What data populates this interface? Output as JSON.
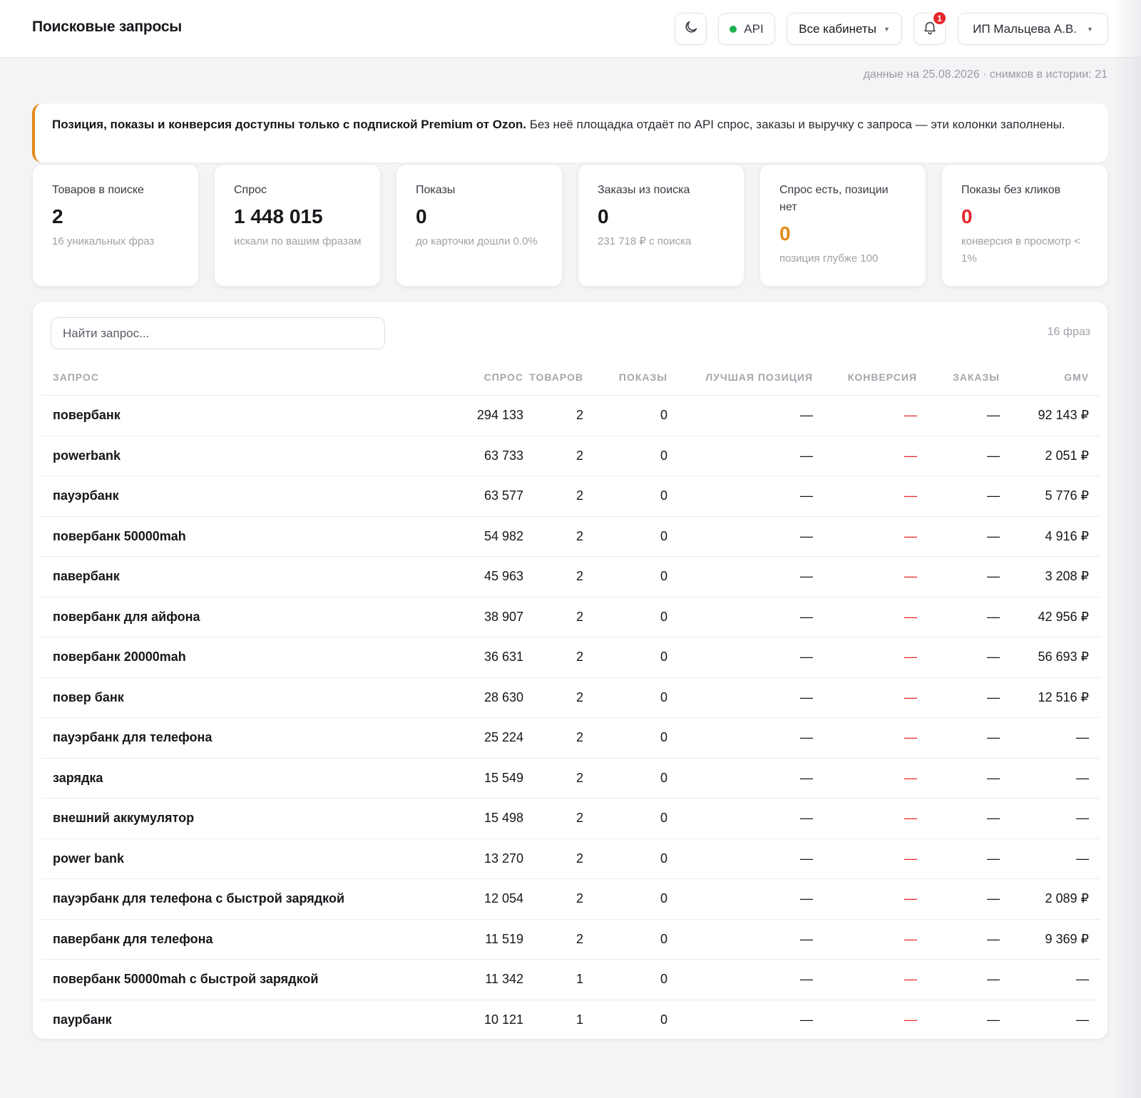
{
  "header": {
    "title": "Поисковые запросы",
    "api_label": "API",
    "cabinets_label": "Все кабинеты",
    "notifications_count": "1",
    "user_label": "ИП Мальцева А.В."
  },
  "data_note": "данные на 25.08.2026 · снимков в истории: 21",
  "notice": {
    "bold": "Позиция, показы и конверсия доступны только с подпиской Premium от Ozon.",
    "text": " Без неё площадка отдаёт по API спрос, заказы и выручку с запроса — эти колонки заполнены."
  },
  "cards": [
    {
      "label": "Товаров в поиске",
      "value": "2",
      "sub": "16 уникальных фраз"
    },
    {
      "label": "Спрос",
      "value": "1 448 015",
      "sub": "искали по вашим фразам"
    },
    {
      "label": "Показы",
      "value": "0",
      "sub": "до карточки дошли 0.0%"
    },
    {
      "label": "Заказы из поиска",
      "value": "0",
      "sub": "231 718 ₽ с поиска"
    },
    {
      "label": "Спрос есть, позиции нет",
      "value": "0",
      "sub": "позиция глубже 100"
    },
    {
      "label": "Показы без кликов",
      "value": "0",
      "sub": "конверсия в просмотр < 1%"
    }
  ],
  "colors": {
    "accent_orange": "#e08a17",
    "alert_red": "#e5262b",
    "api_green": "#1fae4b"
  },
  "table": {
    "search_placeholder": "Найти запрос...",
    "phrase_count": "16 фраз",
    "columns": [
      "Запрос",
      "Спрос",
      "Товаров",
      "Показы",
      "Лучшая позиция",
      "Конверсия",
      "Заказы",
      "GMV"
    ],
    "rows": [
      {
        "query": "повербанк",
        "demand": "294 133",
        "goods": "2",
        "shows": "0",
        "position": "—",
        "conversion": "—",
        "orders": "—",
        "gmv": "92 143 ₽"
      },
      {
        "query": "powerbank",
        "demand": "63 733",
        "goods": "2",
        "shows": "0",
        "position": "—",
        "conversion": "—",
        "orders": "—",
        "gmv": "2 051 ₽"
      },
      {
        "query": "пауэрбанк",
        "demand": "63 577",
        "goods": "2",
        "shows": "0",
        "position": "—",
        "conversion": "—",
        "orders": "—",
        "gmv": "5 776 ₽"
      },
      {
        "query": "повербанк 50000mah",
        "demand": "54 982",
        "goods": "2",
        "shows": "0",
        "position": "—",
        "conversion": "—",
        "orders": "—",
        "gmv": "4 916 ₽"
      },
      {
        "query": "павербанк",
        "demand": "45 963",
        "goods": "2",
        "shows": "0",
        "position": "—",
        "conversion": "—",
        "orders": "—",
        "gmv": "3 208 ₽"
      },
      {
        "query": "повербанк для айфона",
        "demand": "38 907",
        "goods": "2",
        "shows": "0",
        "position": "—",
        "conversion": "—",
        "orders": "—",
        "gmv": "42 956 ₽"
      },
      {
        "query": "повербанк 20000mah",
        "demand": "36 631",
        "goods": "2",
        "shows": "0",
        "position": "—",
        "conversion": "—",
        "orders": "—",
        "gmv": "56 693 ₽"
      },
      {
        "query": "повер банк",
        "demand": "28 630",
        "goods": "2",
        "shows": "0",
        "position": "—",
        "conversion": "—",
        "orders": "—",
        "gmv": "12 516 ₽"
      },
      {
        "query": "пауэрбанк для телефона",
        "demand": "25 224",
        "goods": "2",
        "shows": "0",
        "position": "—",
        "conversion": "—",
        "orders": "—",
        "gmv": "—"
      },
      {
        "query": "зарядка",
        "demand": "15 549",
        "goods": "2",
        "shows": "0",
        "position": "—",
        "conversion": "—",
        "orders": "—",
        "gmv": "—"
      },
      {
        "query": "внешний аккумулятор",
        "demand": "15 498",
        "goods": "2",
        "shows": "0",
        "position": "—",
        "conversion": "—",
        "orders": "—",
        "gmv": "—"
      },
      {
        "query": "power bank",
        "demand": "13 270",
        "goods": "2",
        "shows": "0",
        "position": "—",
        "conversion": "—",
        "orders": "—",
        "gmv": "—"
      },
      {
        "query": "пауэрбанк для телефона с быстрой зарядкой",
        "demand": "12 054",
        "goods": "2",
        "shows": "0",
        "position": "—",
        "conversion": "—",
        "orders": "—",
        "gmv": "2 089 ₽"
      },
      {
        "query": "павербанк для телефона",
        "demand": "11 519",
        "goods": "2",
        "shows": "0",
        "position": "—",
        "conversion": "—",
        "orders": "—",
        "gmv": "9 369 ₽"
      },
      {
        "query": "повербанк 50000mah с быстрой зарядкой",
        "demand": "11 342",
        "goods": "1",
        "shows": "0",
        "position": "—",
        "conversion": "—",
        "orders": "—",
        "gmv": "—"
      },
      {
        "query": "паурбанк",
        "demand": "10 121",
        "goods": "1",
        "shows": "0",
        "position": "—",
        "conversion": "—",
        "orders": "—",
        "gmv": "—"
      }
    ]
  }
}
